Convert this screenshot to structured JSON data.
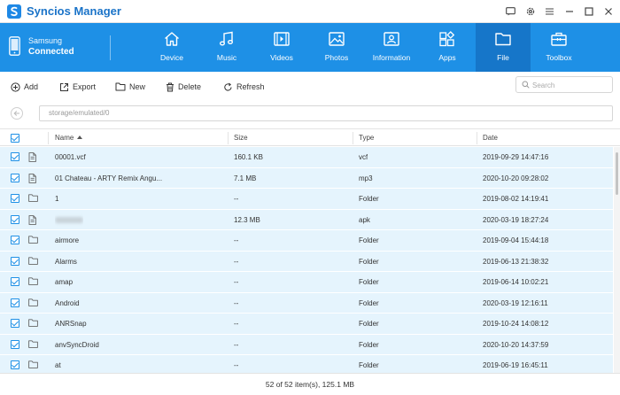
{
  "app": {
    "title": "Syncios Manager"
  },
  "device": {
    "name": "Samsung",
    "status": "Connected"
  },
  "nav": [
    {
      "label": "Device",
      "icon": "home-icon"
    },
    {
      "label": "Music",
      "icon": "music-icon"
    },
    {
      "label": "Videos",
      "icon": "video-icon"
    },
    {
      "label": "Photos",
      "icon": "photo-icon"
    },
    {
      "label": "Information",
      "icon": "contact-card-icon"
    },
    {
      "label": "Apps",
      "icon": "apps-icon"
    },
    {
      "label": "File",
      "icon": "folder-icon",
      "active": true
    },
    {
      "label": "Toolbox",
      "icon": "toolbox-icon"
    }
  ],
  "toolbar": {
    "add_label": "Add",
    "export_label": "Export",
    "new_label": "New",
    "delete_label": "Delete",
    "refresh_label": "Refresh"
  },
  "search": {
    "placeholder": "Search"
  },
  "path": {
    "current": "storage/emulated/0"
  },
  "table": {
    "columns": {
      "name": "Name",
      "size": "Size",
      "type": "Type",
      "date": "Date"
    },
    "rows": [
      {
        "icon": "file-icon",
        "name": "00001.vcf",
        "size": "160.1 KB",
        "type": "vcf",
        "date": "2019-09-29 14:47:16"
      },
      {
        "icon": "file-icon",
        "name": "01 Chateau - ARTY Remix Angu...",
        "size": "7.1 MB",
        "type": "mp3",
        "date": "2020-10-20 09:28:02"
      },
      {
        "icon": "folder-icon",
        "name": "1",
        "size": "--",
        "type": "Folder",
        "date": "2019-08-02 14:19:41"
      },
      {
        "icon": "file-icon",
        "name": "",
        "blurred": true,
        "size": "12.3 MB",
        "type": "apk",
        "date": "2020-03-19 18:27:24"
      },
      {
        "icon": "folder-icon",
        "name": "airmore",
        "size": "--",
        "type": "Folder",
        "date": "2019-09-04 15:44:18"
      },
      {
        "icon": "folder-icon",
        "name": "Alarms",
        "size": "--",
        "type": "Folder",
        "date": "2019-06-13 21:38:32"
      },
      {
        "icon": "folder-icon",
        "name": "amap",
        "size": "--",
        "type": "Folder",
        "date": "2019-06-14 10:02:21"
      },
      {
        "icon": "folder-icon",
        "name": "Android",
        "size": "--",
        "type": "Folder",
        "date": "2020-03-19 12:16:11"
      },
      {
        "icon": "folder-icon",
        "name": "ANRSnap",
        "size": "--",
        "type": "Folder",
        "date": "2019-10-24 14:08:12"
      },
      {
        "icon": "folder-icon",
        "name": "anvSyncDroid",
        "size": "--",
        "type": "Folder",
        "date": "2020-10-20 14:37:59"
      },
      {
        "icon": "folder-icon",
        "name": "at",
        "size": "--",
        "type": "Folder",
        "date": "2019-06-19 16:45:11"
      }
    ]
  },
  "status": {
    "summary": "52 of 52 item(s), 125.1 MB"
  },
  "colors": {
    "accent": "#1e90e6",
    "active_tab": "#1676c9",
    "row_selected": "#e5f4fd"
  }
}
